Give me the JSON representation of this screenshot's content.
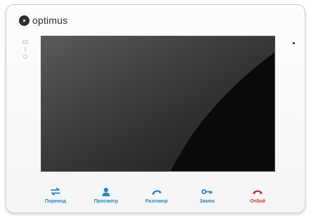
{
  "brand": {
    "name": "optimus"
  },
  "colors": {
    "accent": "#2b86c9",
    "hangup": "#e02a2a"
  },
  "buttons": [
    {
      "label": "Перевод",
      "icon": "transfer-icon",
      "color": "#2b86c9"
    },
    {
      "label": "Просмотр",
      "icon": "user-icon",
      "color": "#2b86c9"
    },
    {
      "label": "Разговор",
      "icon": "phone-answer-icon",
      "color": "#2b86c9"
    },
    {
      "label": "Замок",
      "icon": "key-icon",
      "color": "#2b86c9"
    },
    {
      "label": "Отбой",
      "icon": "phone-hangup-icon",
      "color": "#e02a2a"
    }
  ]
}
